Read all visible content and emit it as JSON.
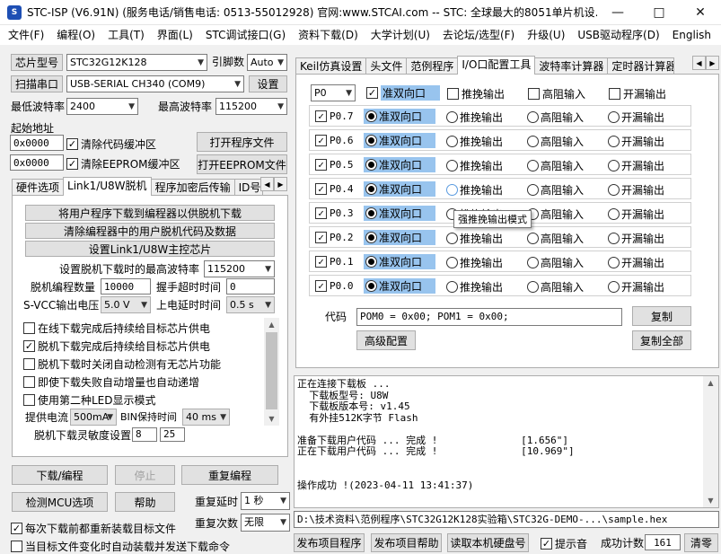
{
  "window": {
    "title": "STC-ISP (V6.91N) (服务电话/销售电话: 0513-55012928) 官网:www.STCAI.com  -- STC: 全球最大的8051单片机设..."
  },
  "menu": [
    "文件(F)",
    "编程(O)",
    "工具(T)",
    "界面(L)",
    "STC调试接口(G)",
    "资料下载(D)",
    "大学计划(U)",
    "去论坛/选型(F)",
    "升级(U)",
    "USB驱动程序(D)",
    "English"
  ],
  "left": {
    "chip_model_button": "芯片型号",
    "chip_model_value": "STC32G12K128",
    "pin_count_label": "引脚数",
    "pin_count_value": "Auto",
    "scan_port_button": "扫描串口",
    "port_value": "USB-SERIAL CH340 (COM9)",
    "settings_button": "设置",
    "min_baud_label": "最低波特率",
    "min_baud_value": "2400",
    "max_baud_label": "最高波特率",
    "max_baud_value": "115200",
    "start_addr_label": "起始地址",
    "addr1_value": "0x0000",
    "clear_code_label": "清除代码缓冲区",
    "open_program_button": "打开程序文件",
    "addr2_value": "0x0000",
    "clear_eeprom_label": "清除EEPROM缓冲区",
    "open_eeprom_button": "打开EEPROM文件",
    "tabs": [
      "硬件选项",
      "Link1/U8W脱机",
      "程序加密后传输",
      "ID号"
    ],
    "offline": {
      "btn1": "将用户程序下载到编程器以供脱机下载",
      "btn2": "清除编程器中的用户脱机代码及数据",
      "btn3": "设置Link1/U8W主控芯片",
      "max_baud_label": "设置脱机下载时的最高波特率",
      "max_baud_value": "115200",
      "count_label": "脱机编程数量",
      "count_value": "10000",
      "handshake_label": "握手超时时间",
      "handshake_value": "0",
      "svcc_label": "S-VCC输出电压",
      "svcc_value": "5.0 V",
      "power_delay_label": "上电延时时间",
      "power_delay_value": "0.5 s",
      "options": [
        {
          "label": "在线下载完成后持续给目标芯片供电",
          "checked": false
        },
        {
          "label": "脱机下载完成后持续给目标芯片供电",
          "checked": true
        },
        {
          "label": "脱机下载时关闭自动检测有无芯片功能",
          "checked": false
        },
        {
          "label": "即使下载失败自动增量也自动递增",
          "checked": false
        },
        {
          "label": "使用第二种LED显示模式",
          "checked": false
        }
      ],
      "current_label": "提供电流",
      "current_value": "500mA",
      "bin_hold_label": "BIN保持时间",
      "bin_hold_value": "40 ms",
      "sensitivity_label": "脱机下载灵敏度设置",
      "sens1": "8",
      "sens2": "25"
    },
    "download_button": "下载/编程",
    "stop_button": "停止",
    "reprogram_button": "重复编程",
    "detect_mcu_button": "检测MCU选项",
    "help_button": "帮助",
    "repeat_delay_label": "重复延时",
    "repeat_delay_value": "1 秒",
    "repeat_count_label": "重复次数",
    "repeat_count_value": "无限",
    "reload_label": "每次下载前都重新装载目标文件",
    "reload_checked": true,
    "auto_send_label": "当目标文件变化时自动装载并发送下载命令",
    "auto_send_checked": false
  },
  "right": {
    "tabs": [
      "Keil仿真设置",
      "头文件",
      "范例程序",
      "I/O口配置工具",
      "波特率计算器",
      "定时器计算器"
    ],
    "port_select": "P0",
    "modes": [
      "准双向口",
      "推挽输出",
      "高阻输入",
      "开漏输出"
    ],
    "pins": [
      {
        "name": "P0.7",
        "mode": 0
      },
      {
        "name": "P0.6",
        "mode": 0
      },
      {
        "name": "P0.5",
        "mode": 0
      },
      {
        "name": "P0.4",
        "mode": 0
      },
      {
        "name": "P0.3",
        "mode": 0
      },
      {
        "name": "P0.2",
        "mode": 0
      },
      {
        "name": "P0.1",
        "mode": 0
      },
      {
        "name": "P0.0",
        "mode": 0
      }
    ],
    "tooltip": "强推挽输出模式",
    "code_label": "代码",
    "code_value": "POM0 = 0x00; POM1 = 0x00;",
    "copy_button": "复制",
    "advanced_button": "高级配置",
    "copy_all_button": "复制全部",
    "log": [
      "正在连接下载板 ...",
      "  下载板型号: U8W",
      "  下载板版本号: v1.45",
      "  有外挂512K字节 Flash",
      "",
      "准备下载用户代码 ... 完成 !              [1.656\"]",
      "正在下载用户代码 ... 完成 !              [10.969\"]",
      "",
      "",
      "操作成功 !(2023-04-11 13:41:37)"
    ],
    "path": "D:\\技术资料\\范例程序\\STC32G12K128实验箱\\STC32G-DEMO-...\\sample.hex",
    "publish_project_button": "发布项目程序",
    "publish_help_button": "发布项目帮助",
    "read_serial_button": "读取本机硬盘号",
    "beep_label": "提示音",
    "beep_checked": true,
    "success_count_label": "成功计数",
    "success_count_value": "161",
    "clear_button": "清零"
  }
}
